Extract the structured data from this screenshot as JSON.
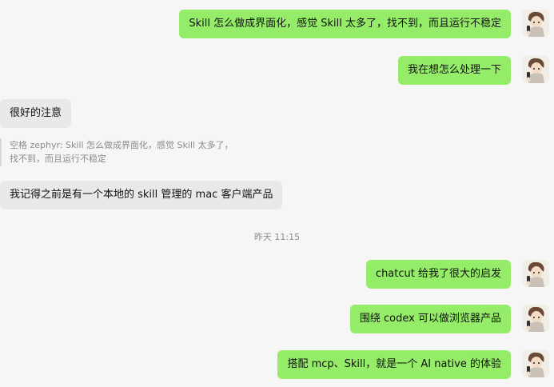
{
  "chat": {
    "messages": [
      {
        "side": "right",
        "text": "Skill 怎么做成界面化，感觉 Skill 太多了，找不到，而且运行不稳定"
      },
      {
        "side": "right",
        "text": "我在想怎么处理一下"
      },
      {
        "side": "left",
        "text": "很好的注意"
      },
      {
        "side": "left",
        "quote": "空格 zephyr: Skill 怎么做成界面化，感觉 Skill 太多了，找不到，而且运行不稳定"
      },
      {
        "side": "left",
        "text": "我记得之前是有一个本地的 skill 管理的 mac 客户端产品"
      },
      {
        "timestamp": "昨天 11:15"
      },
      {
        "side": "right",
        "text": "chatcut 给我了很大的启发"
      },
      {
        "side": "right",
        "text": "围绕 codex 可以做浏览器产品"
      },
      {
        "side": "right",
        "text": "搭配 mcp、Skill，就是一个 AI native 的体验"
      }
    ]
  },
  "colors": {
    "background": "#f6f6f6",
    "outgoing_bubble": "#95ec69",
    "incoming_bubble": "#e9e9e9",
    "timestamp_text": "#8b8b8b",
    "quote_text": "#8a8a8a",
    "quote_border": "#d8d8d8"
  },
  "icons": {
    "avatar": "anime-avatar-icon"
  }
}
